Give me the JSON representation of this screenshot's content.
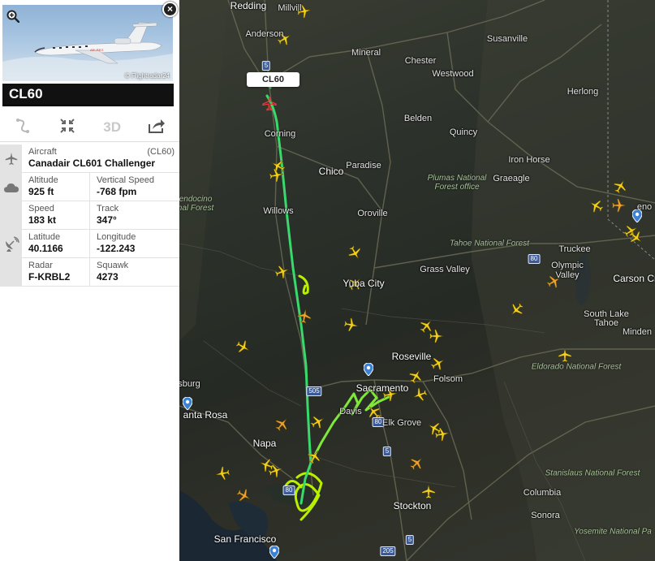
{
  "panel": {
    "callsign": "CL60",
    "photo_credit": "© Flightradar24",
    "toolbar": {
      "route_icon": "route-icon",
      "fit_icon": "fit-view-icon",
      "three_d_label": "3D",
      "share_icon": "share-icon"
    },
    "aircraft": {
      "label": "Aircraft",
      "code": "(CL60)",
      "value": "Canadair CL601 Challenger"
    },
    "altitude": {
      "label": "Altitude",
      "value": "925 ft"
    },
    "vertical_speed": {
      "label": "Vertical Speed",
      "value": "-768 fpm"
    },
    "speed": {
      "label": "Speed",
      "value": "183 kt"
    },
    "track": {
      "label": "Track",
      "value": "347°"
    },
    "latitude": {
      "label": "Latitude",
      "value": "40.1166"
    },
    "longitude": {
      "label": "Longitude",
      "value": "-122.243"
    },
    "radar": {
      "label": "Radar",
      "value": "F-KRBL2"
    },
    "squawk": {
      "label": "Squawk",
      "value": "4273"
    }
  },
  "map": {
    "flight_label": "CL60",
    "cities": {
      "redding": "Redding",
      "millville": "Millvill",
      "anderson": "Anderson",
      "mineral": "Mineral",
      "chester": "Chester",
      "westwood": "Westwood",
      "susanville": "Susanville",
      "herlong": "Herlong",
      "belden": "Belden",
      "quincy": "Quincy",
      "corning": "Corning",
      "chico": "Chico",
      "paradise": "Paradise",
      "iron_horse": "Iron Horse",
      "graeagle": "Graeagle",
      "willows": "Willows",
      "oroville": "Oroville",
      "reno": "eno",
      "truckee": "Truckee",
      "grass_valley": "Grass Valley",
      "olympic_valley": "Olympic\nValley",
      "yuba_city": "Yuba City",
      "carson_city": "Carson Ci",
      "south_lake_tahoe": "South Lake\nTahoe",
      "minden": "Minden",
      "roseville": "Roseville",
      "sacramento": "Sacramento",
      "folsom": "Folsom",
      "healdsburg": "sburg",
      "santa_rosa": "anta Rosa",
      "davis": "Davis",
      "elk_grove": "Elk Grove",
      "napa": "Napa",
      "stockton": "Stockton",
      "columbia": "Columbia",
      "sonora": "Sonora",
      "san_francisco": "San Francisco"
    },
    "forests": {
      "plumas": "Plumas National\nForest office",
      "mendocino": "endocino\nnal Forest",
      "tahoe": "Tahoe National Forest",
      "eldorado": "Eldorado National Forest",
      "stanislaus": "Stanislaus National Forest",
      "yosemite": "Yosemite National Pa"
    },
    "highways": {
      "i5_north": "5",
      "i80": "80",
      "i505": "505",
      "i5_south": "5",
      "i80_sw": "80",
      "i205": "205",
      "r5_mid": "5",
      "r80_elk": "80"
    },
    "colors": {
      "track": "#3ad96b",
      "track_loop": "#b8f000",
      "plane": "#f3d11a",
      "plane_orange": "#f0a030",
      "selected": "#e83a3a",
      "water": "#1b2733"
    }
  }
}
